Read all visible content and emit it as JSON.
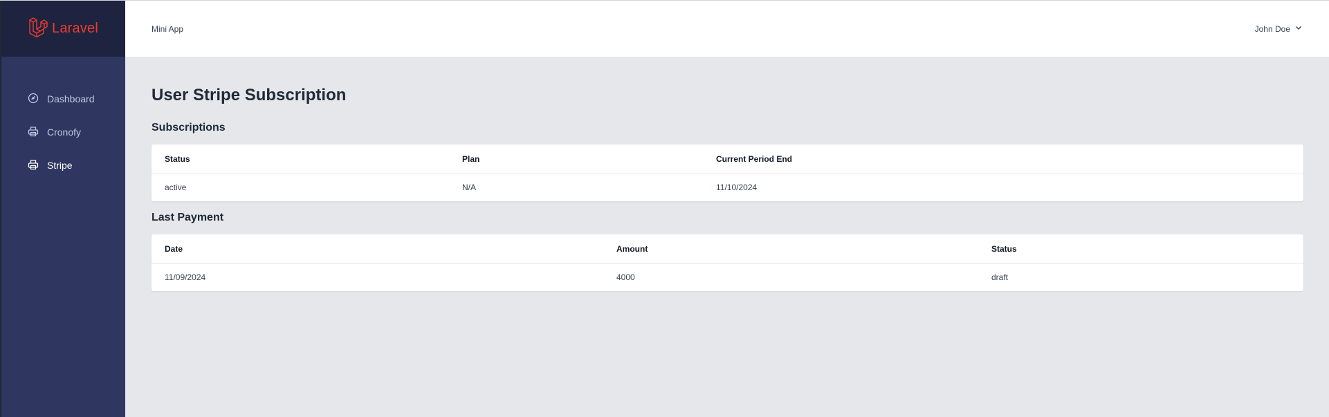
{
  "brand": {
    "name": "Laravel",
    "color": "#ef3b2d",
    "icon": "laravel-logo-icon"
  },
  "sidebar": {
    "items": [
      {
        "label": "Dashboard",
        "icon": "dashboard-gauge-icon",
        "active": false
      },
      {
        "label": "Cronofy",
        "icon": "printer-icon",
        "active": false
      },
      {
        "label": "Stripe",
        "icon": "printer-icon",
        "active": true
      }
    ]
  },
  "header": {
    "app_name": "Mini App",
    "user_name": "John Doe",
    "user_icon": "chevron-down-icon"
  },
  "page": {
    "title": "User Stripe Subscription"
  },
  "subscriptions": {
    "title": "Subscriptions",
    "columns": [
      "Status",
      "Plan",
      "Current Period End"
    ],
    "rows": [
      [
        "active",
        "N/A",
        "11/10/2024"
      ]
    ]
  },
  "last_payment": {
    "title": "Last Payment",
    "columns": [
      "Date",
      "Amount",
      "Status"
    ],
    "rows": [
      [
        "11/09/2024",
        "4000",
        "draft"
      ]
    ]
  },
  "colors": {
    "sidebar": "#2f365f",
    "brand_bar": "#1e2340",
    "background": "#e5e7eb"
  }
}
